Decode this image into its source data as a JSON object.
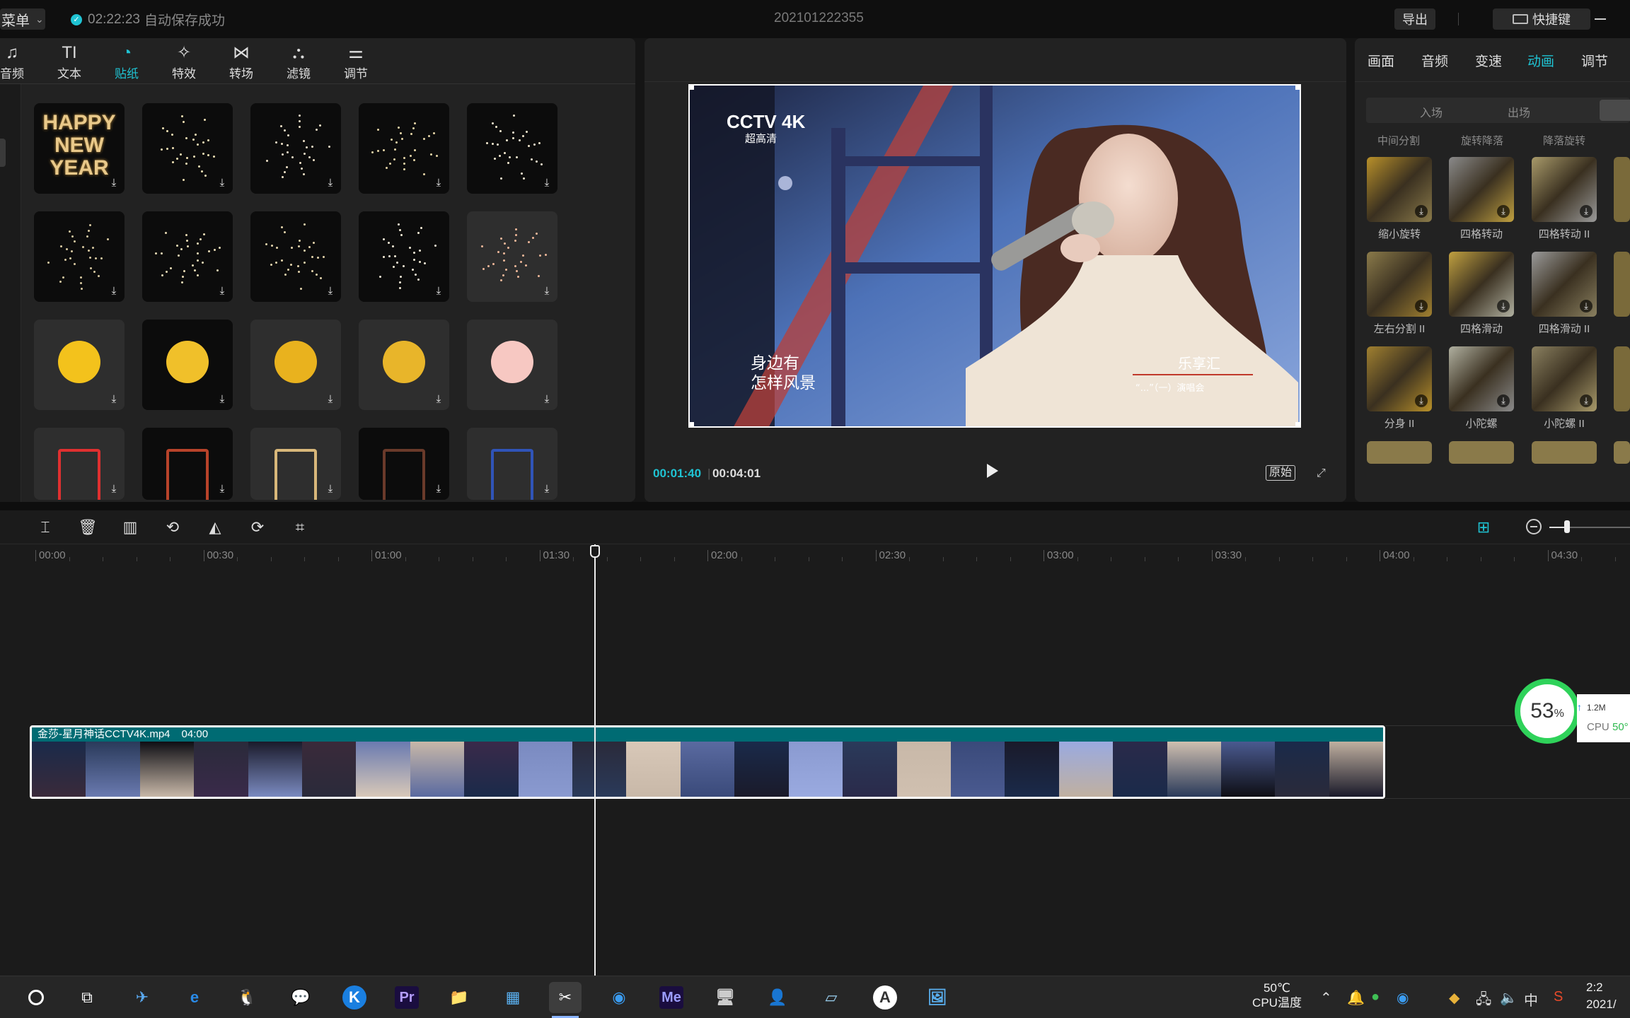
{
  "topbar": {
    "menu_label": "菜单",
    "autosave_time": "02:22:23",
    "autosave_text": "自动保存成功",
    "project_title": "202101222355",
    "export_label": "导出",
    "shortcut_label": "快捷键"
  },
  "media_tabs": [
    {
      "label": "音频",
      "icon": "music-note-icon"
    },
    {
      "label": "文本",
      "icon": "text-icon"
    },
    {
      "label": "贴纸",
      "icon": "sticker-icon",
      "active": true
    },
    {
      "label": "特效",
      "icon": "sparkle-icon"
    },
    {
      "label": "转场",
      "icon": "transition-icon"
    },
    {
      "label": "滤镜",
      "icon": "filter-icon"
    },
    {
      "label": "调节",
      "icon": "adjust-sliders-icon"
    }
  ],
  "stickers": [
    {
      "name": "happy-new-year",
      "text": "HAPPY NEW YEAR"
    },
    {
      "name": "firework-burst-1"
    },
    {
      "name": "firework-heart"
    },
    {
      "name": "firework-star"
    },
    {
      "name": "firework-burst-2"
    },
    {
      "name": "firework-spray"
    },
    {
      "name": "firework-burst-3"
    },
    {
      "name": "firework-burst-4"
    },
    {
      "name": "firework-dots"
    },
    {
      "name": "sparkler"
    },
    {
      "name": "gold-ingot"
    },
    {
      "name": "gold-sparkle-trail"
    },
    {
      "name": "dollar-eyes"
    },
    {
      "name": "gold-chain"
    },
    {
      "name": "cartoon-hand"
    },
    {
      "name": "red-envelope-hand"
    },
    {
      "name": "red-frame"
    },
    {
      "name": "gold-oval-frame"
    },
    {
      "name": "lantern-frame"
    },
    {
      "name": "blue-frame"
    }
  ],
  "player": {
    "current_time": "00:01:40",
    "total_time": "00:04:01",
    "ratio_label": "原始",
    "video": {
      "channel_logo": "CCTV 4K",
      "channel_sub": "超高清",
      "subtitle_line1": "身边有",
      "subtitle_line2": "怎样风景",
      "caption_name": "乐享汇",
      "caption_sub": "“...”（一）演唱会"
    }
  },
  "inspector": {
    "tabs": [
      {
        "label": "画面"
      },
      {
        "label": "音频"
      },
      {
        "label": "变速"
      },
      {
        "label": "动画",
        "active": true
      },
      {
        "label": "调节"
      }
    ],
    "segment": {
      "in": "入场",
      "out": "出场"
    },
    "header_row": [
      "中间分割",
      "旋转降落",
      "降落旋转"
    ],
    "animations": [
      {
        "label": "缩小旋转"
      },
      {
        "label": "四格转动"
      },
      {
        "label": "四格转动 II"
      },
      {
        "label": "左右分割 II"
      },
      {
        "label": "四格滑动"
      },
      {
        "label": "四格滑动 II"
      },
      {
        "label": "分身 II"
      },
      {
        "label": "小陀螺"
      },
      {
        "label": "小陀螺 II"
      }
    ]
  },
  "timeline": {
    "ruler": [
      "00:00",
      "00:30",
      "01:00",
      "01:30",
      "02:00",
      "02:30",
      "03:00",
      "03:30",
      "04:00",
      "04:30"
    ],
    "clip": {
      "filename": "金莎-星月神话CCTV4K.mp4",
      "duration": "04:00"
    }
  },
  "perf_widget": {
    "percent": "53",
    "unit": "%",
    "net": "1.2M",
    "cpu_label": "CPU",
    "cpu_value": "50°"
  },
  "taskbar": {
    "temp_value": "50℃",
    "temp_label": "CPU温度",
    "ime": "中",
    "clock_time": "2:2",
    "clock_date": "2021/"
  },
  "colors": {
    "accent": "#1fc3d3",
    "clip_header": "#006b73",
    "perf_ring": "#2fd25a"
  }
}
